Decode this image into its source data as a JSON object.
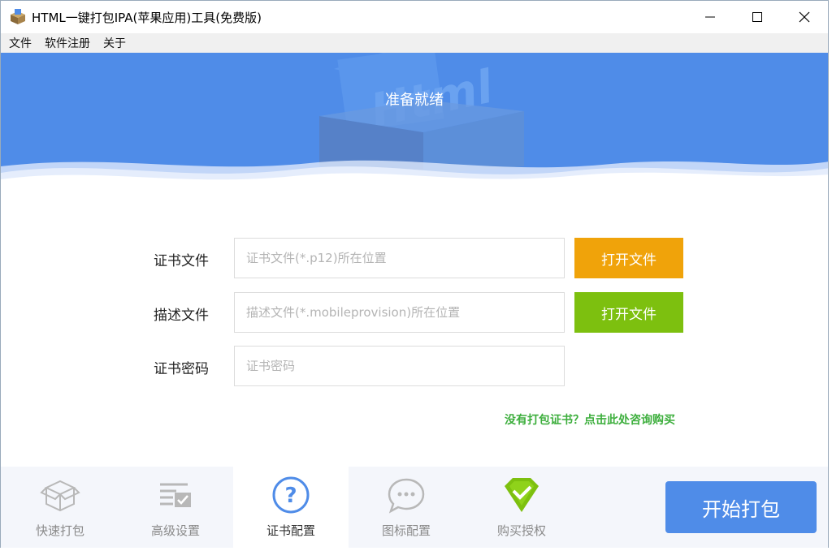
{
  "window": {
    "title": "HTML一键打包IPA(苹果应用)工具(免费版)",
    "minimize_icon": "minimize-icon",
    "maximize_icon": "maximize-icon",
    "close_icon": "close-icon"
  },
  "menu": {
    "items": [
      "文件",
      "软件注册",
      "关于"
    ]
  },
  "banner": {
    "status": "准备就绪",
    "watermark": "Html"
  },
  "form": {
    "rows": [
      {
        "label": "证书文件",
        "placeholder": "证书文件(*.p12)所在位置",
        "button": "打开文件",
        "button_color": "#f0a30a"
      },
      {
        "label": "描述文件",
        "placeholder": "描述文件(*.mobileprovision)所在位置",
        "button": "打开文件",
        "button_color": "#7dc00f"
      },
      {
        "label": "证书密码",
        "placeholder": "证书密码"
      }
    ],
    "link": "没有打包证书？点击此处咨询购买"
  },
  "tabs": [
    {
      "label": "快速打包",
      "icon": "box-icon",
      "active": false
    },
    {
      "label": "高级设置",
      "icon": "settings-list-icon",
      "active": false
    },
    {
      "label": "证书配置",
      "icon": "question-icon",
      "active": true
    },
    {
      "label": "图标配置",
      "icon": "chat-bubble-icon",
      "active": false
    },
    {
      "label": "购买授权",
      "icon": "diamond-check-icon",
      "active": false
    }
  ],
  "start_button": "开始打包",
  "colors": {
    "accent": "#4f8ce8",
    "orange": "#f0a30a",
    "green": "#7dc00f",
    "link": "#3cae3c"
  }
}
